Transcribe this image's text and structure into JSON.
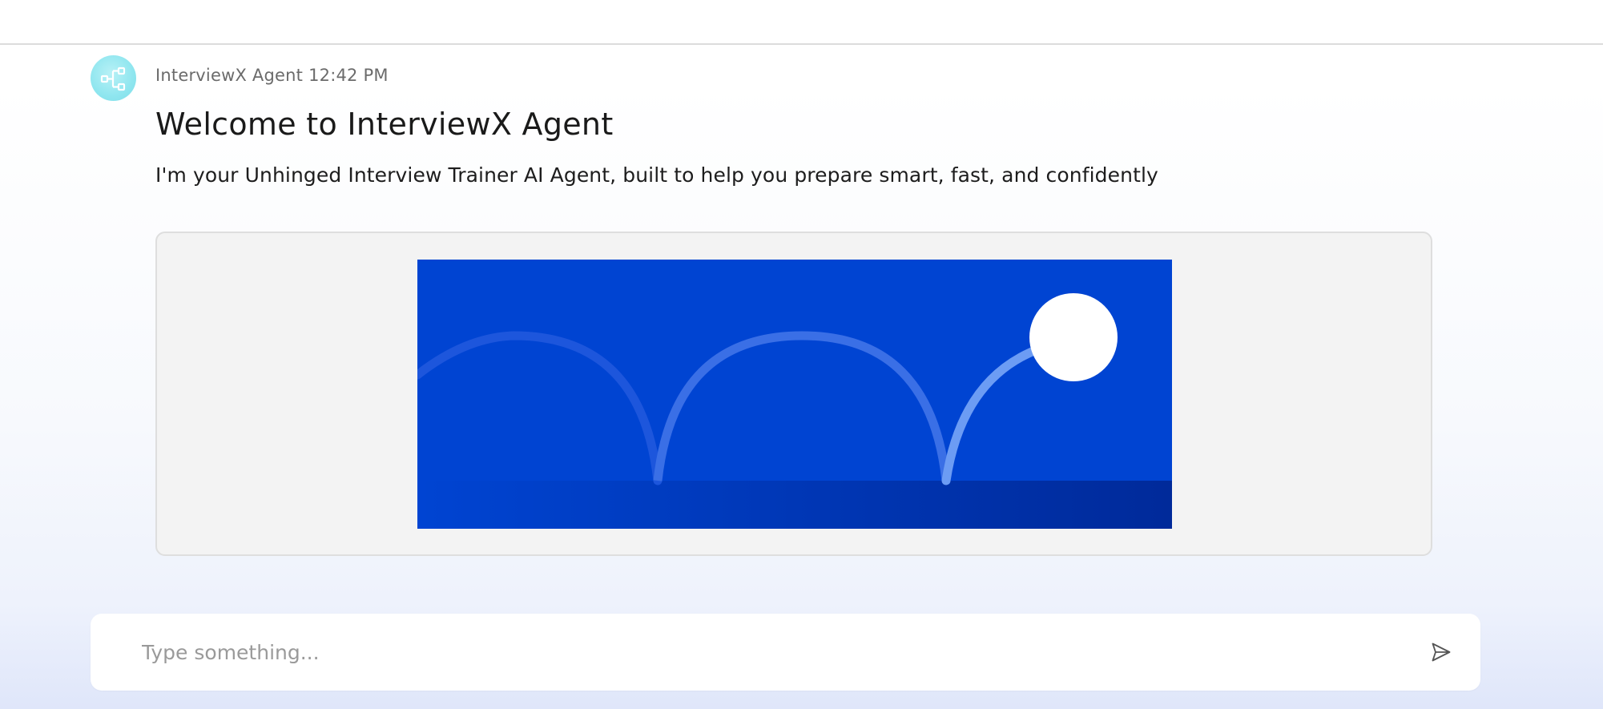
{
  "message": {
    "sender": "InterviewX Agent",
    "time": "12:42 PM",
    "title": "Welcome to InterviewX Agent",
    "body": "I'm your Unhinged Interview Trainer AI Agent, built to help you prepare smart, fast, and confidently",
    "avatar_icon": "flow-diagram-icon",
    "banner_icon": "bouncing-ball-illustration"
  },
  "composer": {
    "placeholder": "Type something...",
    "value": "",
    "send_icon": "send-icon"
  },
  "colors": {
    "banner_blue": "#0044d2",
    "arc": "#5b8ff2",
    "avatar": "#8fe6ef"
  }
}
